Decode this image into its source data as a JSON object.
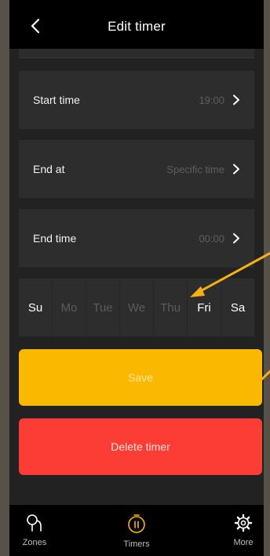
{
  "header": {
    "title": "Edit timer",
    "back_icon": "chevron-left-icon"
  },
  "settings": [
    {
      "label": "Start time",
      "value": "19:00"
    },
    {
      "label": "End at",
      "value": "Specific time"
    },
    {
      "label": "End time",
      "value": "00:00"
    }
  ],
  "days": [
    {
      "label": "Su",
      "active": true
    },
    {
      "label": "Mo",
      "active": false
    },
    {
      "label": "Tue",
      "active": false
    },
    {
      "label": "We",
      "active": false
    },
    {
      "label": "Thu",
      "active": false
    },
    {
      "label": "Fri",
      "active": true
    },
    {
      "label": "Sa",
      "active": true
    }
  ],
  "actions": {
    "save_label": "Save",
    "delete_label": "Delete timer"
  },
  "tabs": [
    {
      "label": "Zones",
      "icon": "zones-icon",
      "active": false
    },
    {
      "label": "Timers",
      "icon": "timers-icon",
      "active": true
    },
    {
      "label": "More",
      "icon": "gear-icon",
      "active": false
    }
  ],
  "colors": {
    "save": "#fbb800",
    "delete": "#fc3d35",
    "accent": "#fbb800",
    "annotation_arrow": "#f4b016"
  }
}
